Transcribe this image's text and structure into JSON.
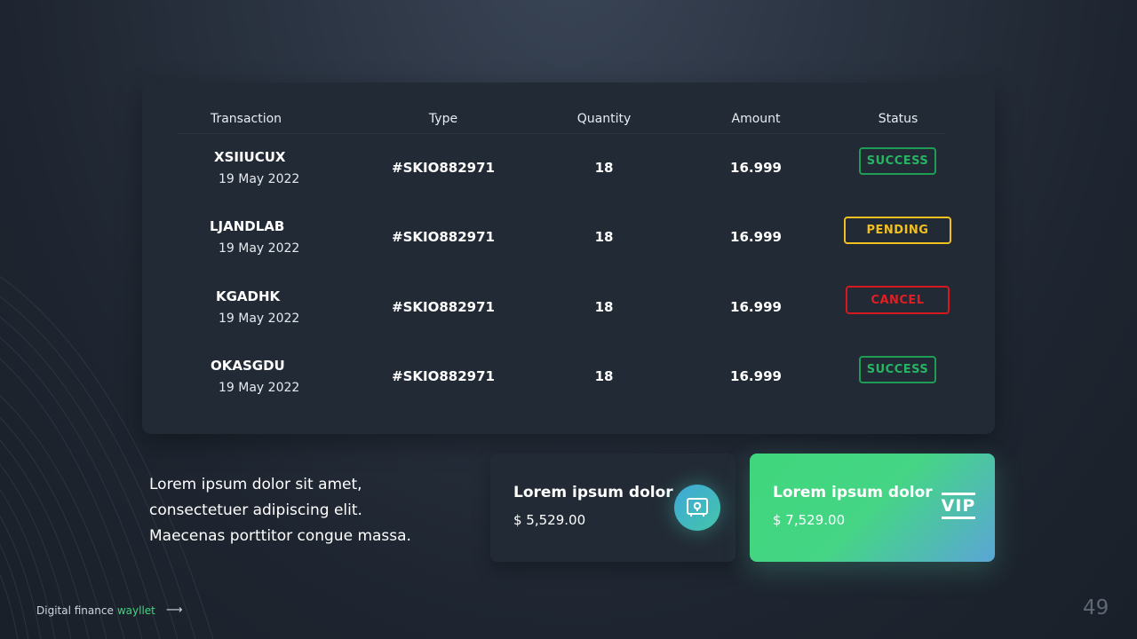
{
  "table": {
    "headers": [
      "Transaction",
      "Type",
      "Quantity",
      "Amount",
      "Status"
    ],
    "rows": [
      {
        "name": "XSIIUCUX",
        "date": "19 May 2022",
        "type": "#SKIO882971",
        "quantity": "18",
        "amount": "16.999",
        "status": "SUCCESS",
        "status_kind": "success"
      },
      {
        "name": "LJANDLAB",
        "date": "19 May 2022",
        "type": "#SKIO882971",
        "quantity": "18",
        "amount": "16.999",
        "status": "PENDING",
        "status_kind": "pending"
      },
      {
        "name": "KGADHK",
        "date": "19 May 2022",
        "type": "#SKIO882971",
        "quantity": "18",
        "amount": "16.999",
        "status": "CANCEL",
        "status_kind": "cancel"
      },
      {
        "name": "OKASGDU",
        "date": "19 May 2022",
        "type": "#SKIO882971",
        "quantity": "18",
        "amount": "16.999",
        "status": "SUCCESS",
        "status_kind": "success"
      }
    ]
  },
  "description": {
    "line1": "Lorem ipsum dolor sit amet,",
    "line2": "consectetuer adipiscing elit.",
    "line3": "Maecenas porttitor congue massa."
  },
  "cards": [
    {
      "title": "Lorem ipsum dolor",
      "amount": "$ 5,529.00",
      "icon": "safe-icon"
    },
    {
      "title": "Lorem ipsum dolor",
      "amount": "$ 7,529.00",
      "icon": "vip-icon",
      "badge_text": "VIP"
    }
  ],
  "footer": {
    "text": "Digital finance",
    "brand": "wayllet",
    "arrow": "⟶"
  },
  "page_number": "49",
  "colors": {
    "success": "#26b562",
    "pending": "#f2c01e",
    "cancel": "#e01e24",
    "accent": "#3fd67c"
  }
}
